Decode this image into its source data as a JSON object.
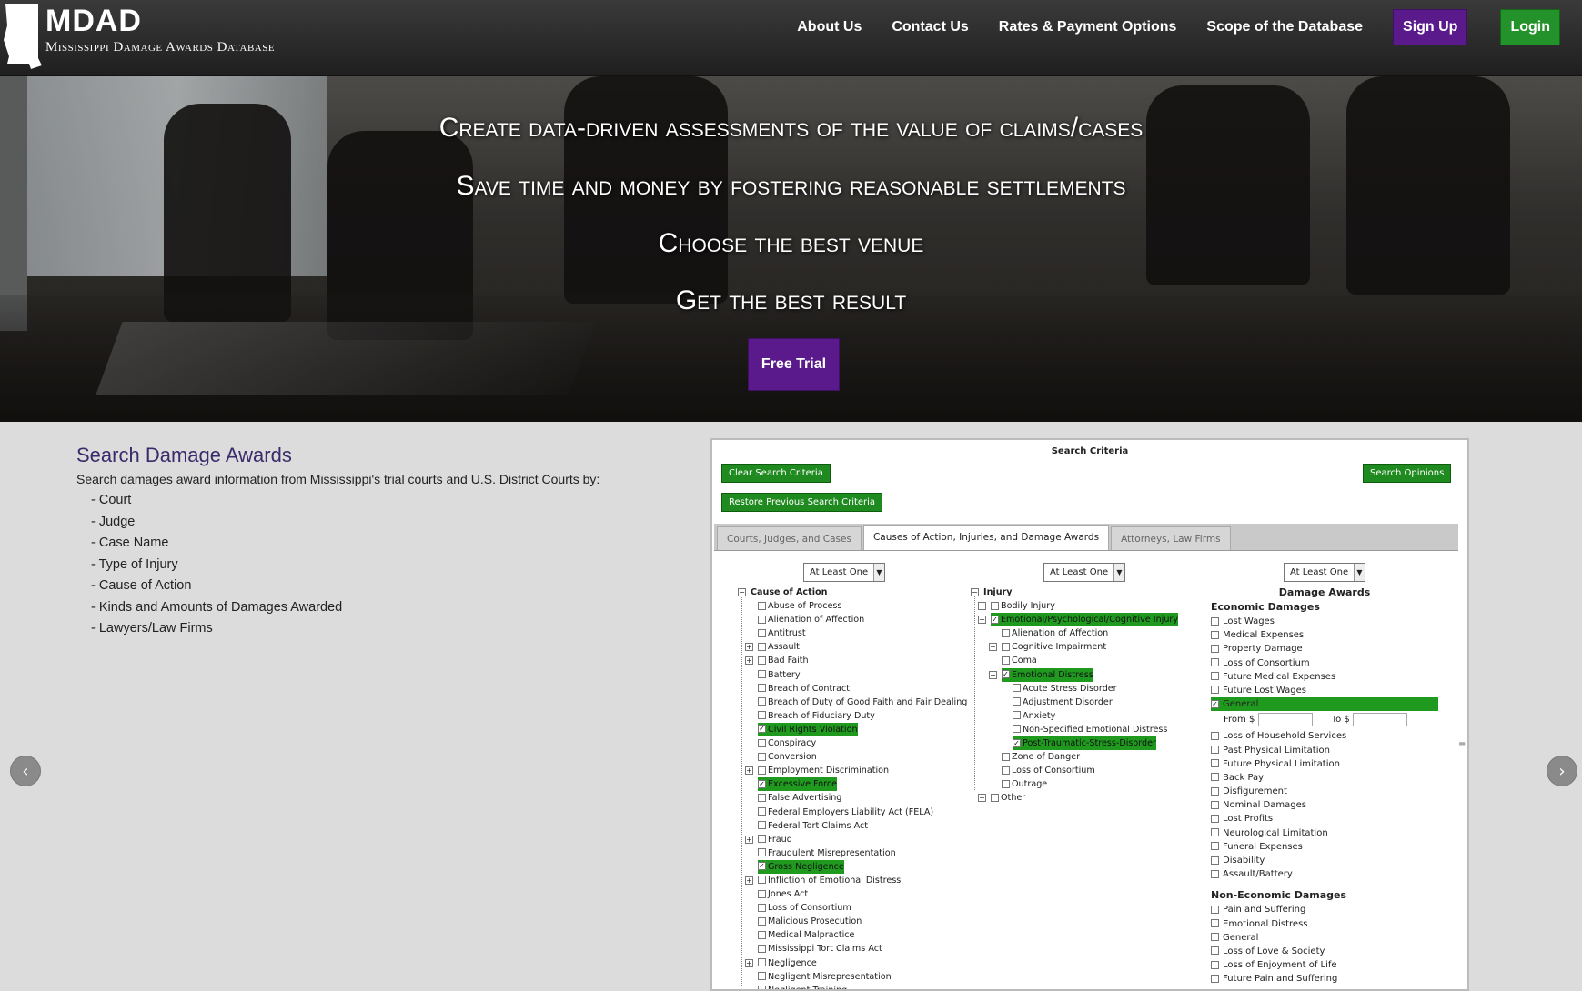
{
  "header": {
    "logo_title": "MDAD",
    "logo_subtitle": "Mississippi Damage Awards Database",
    "nav": [
      "About Us",
      "Contact Us",
      "Rates & Payment Options",
      "Scope of the Database"
    ],
    "signup_label": "Sign Up",
    "login_label": "Login"
  },
  "hero": {
    "taglines": [
      "Create data-driven assessments of the value of claims/cases",
      "Save time and money by fostering reasonable settlements",
      "Choose the best venue",
      "Get the best result"
    ],
    "trial_button": "Free Trial"
  },
  "info": {
    "title": "Search Damage Awards",
    "description": "Search damages award information from Mississippi's trial courts and U.S. District Courts by:",
    "items": [
      "- Court",
      "- Judge",
      "- Case Name",
      "- Type of Injury",
      "- Cause of Action",
      "- Kinds and Amounts of Damages Awarded",
      "- Lawyers/Law Firms"
    ]
  },
  "carousel": {
    "prev_icon": "‹",
    "next_icon": "›"
  },
  "panel": {
    "title": "Search Criteria",
    "clear_button": "Clear Search Criteria",
    "restore_button": "Restore Previous Search Criteria",
    "search_button": "Search Opinions",
    "tabs": [
      "Courts, Judges, and Cases",
      "Causes of Action, Injuries, and Damage Awards",
      "Attorneys, Law Firms"
    ],
    "active_tab": 1,
    "select_value": "At Least One",
    "cause_root": "Cause of Action",
    "causes": [
      {
        "label": "Abuse of Process",
        "exp": false,
        "checked": false,
        "hl": false
      },
      {
        "label": "Alienation of Affection",
        "exp": false,
        "checked": false,
        "hl": false
      },
      {
        "label": "Antitrust",
        "exp": false,
        "checked": false,
        "hl": false
      },
      {
        "label": "Assault",
        "exp": true,
        "checked": false,
        "hl": false
      },
      {
        "label": "Bad Faith",
        "exp": true,
        "checked": false,
        "hl": false
      },
      {
        "label": "Battery",
        "exp": false,
        "checked": false,
        "hl": false
      },
      {
        "label": "Breach of Contract",
        "exp": false,
        "checked": false,
        "hl": false
      },
      {
        "label": "Breach of Duty of Good Faith and Fair Dealing",
        "exp": false,
        "checked": false,
        "hl": false
      },
      {
        "label": "Breach of Fiduciary Duty",
        "exp": false,
        "checked": false,
        "hl": false
      },
      {
        "label": "Civil Rights Violation",
        "exp": false,
        "checked": true,
        "hl": true
      },
      {
        "label": "Conspiracy",
        "exp": false,
        "checked": false,
        "hl": false
      },
      {
        "label": "Conversion",
        "exp": false,
        "checked": false,
        "hl": false
      },
      {
        "label": "Employment Discrimination",
        "exp": true,
        "checked": false,
        "hl": false
      },
      {
        "label": "Excessive Force",
        "exp": false,
        "checked": true,
        "hl": true
      },
      {
        "label": "False Advertising",
        "exp": false,
        "checked": false,
        "hl": false
      },
      {
        "label": "Federal Employers Liability Act (FELA)",
        "exp": false,
        "checked": false,
        "hl": false
      },
      {
        "label": "Federal Tort Claims Act",
        "exp": false,
        "checked": false,
        "hl": false
      },
      {
        "label": "Fraud",
        "exp": true,
        "checked": false,
        "hl": false
      },
      {
        "label": "Fraudulent Misrepresentation",
        "exp": false,
        "checked": false,
        "hl": false
      },
      {
        "label": "Gross Negligence",
        "exp": false,
        "checked": true,
        "hl": true
      },
      {
        "label": "Infliction of Emotional Distress",
        "exp": true,
        "checked": false,
        "hl": false
      },
      {
        "label": "Jones Act",
        "exp": false,
        "checked": false,
        "hl": false
      },
      {
        "label": "Loss of Consortium",
        "exp": false,
        "checked": false,
        "hl": false
      },
      {
        "label": "Malicious Prosecution",
        "exp": false,
        "checked": false,
        "hl": false
      },
      {
        "label": "Medical Malpractice",
        "exp": false,
        "checked": false,
        "hl": false
      },
      {
        "label": "Mississippi Tort Claims Act",
        "exp": false,
        "checked": false,
        "hl": false
      },
      {
        "label": "Negligence",
        "exp": true,
        "checked": false,
        "hl": false
      },
      {
        "label": "Negligent Misrepresentation",
        "exp": false,
        "checked": false,
        "hl": false
      },
      {
        "label": "Negligent Training",
        "exp": false,
        "checked": false,
        "hl": false
      }
    ],
    "injury_root": "Injury",
    "injuries": [
      {
        "label": "Bodily Injury",
        "level": 0,
        "exp": "+",
        "checked": false,
        "hl": false
      },
      {
        "label": "Emotional/Psychological/Cognitive Injury",
        "level": 0,
        "exp": "-",
        "checked": true,
        "hl": true
      },
      {
        "label": "Alienation of Affection",
        "level": 1,
        "exp": "",
        "checked": false,
        "hl": false
      },
      {
        "label": "Cognitive Impairment",
        "level": 1,
        "exp": "+",
        "checked": false,
        "hl": false
      },
      {
        "label": "Coma",
        "level": 1,
        "exp": "",
        "checked": false,
        "hl": false
      },
      {
        "label": "Emotional Distress",
        "level": 1,
        "exp": "-",
        "checked": true,
        "hl": true
      },
      {
        "label": "Acute Stress Disorder",
        "level": 2,
        "exp": "",
        "checked": false,
        "hl": false
      },
      {
        "label": "Adjustment Disorder",
        "level": 2,
        "exp": "",
        "checked": false,
        "hl": false
      },
      {
        "label": "Anxiety",
        "level": 2,
        "exp": "",
        "checked": false,
        "hl": false
      },
      {
        "label": "Non-Specified Emotional Distress",
        "level": 2,
        "exp": "",
        "checked": false,
        "hl": false
      },
      {
        "label": "Post-Traumatic-Stress-Disorder",
        "level": 2,
        "exp": "",
        "checked": true,
        "hl": true
      },
      {
        "label": "Zone of Danger",
        "level": 1,
        "exp": "",
        "checked": false,
        "hl": false
      },
      {
        "label": "Loss of Consortium",
        "level": 1,
        "exp": "",
        "checked": false,
        "hl": false
      },
      {
        "label": "Outrage",
        "level": 1,
        "exp": "",
        "checked": false,
        "hl": false
      },
      {
        "label": "Other",
        "level": 0,
        "exp": "+",
        "checked": false,
        "hl": false
      }
    ],
    "damages_title": "Damage Awards",
    "economic_title": "Economic Damages",
    "economic_before": [
      {
        "label": "Lost Wages",
        "checked": false,
        "hl": false
      },
      {
        "label": "Medical Expenses",
        "checked": false,
        "hl": false
      },
      {
        "label": "Property Damage",
        "checked": false,
        "hl": false
      },
      {
        "label": "Loss of Consortium",
        "checked": false,
        "hl": false
      },
      {
        "label": "Future Medical Expenses",
        "checked": false,
        "hl": false
      },
      {
        "label": "Future Lost Wages",
        "checked": false,
        "hl": false
      },
      {
        "label": "General",
        "checked": true,
        "hl": true
      }
    ],
    "from_label": "From $",
    "to_label": "To $",
    "economic_after": [
      {
        "label": "Loss of Household Services",
        "checked": false
      },
      {
        "label": "Past Physical Limitation",
        "checked": false
      },
      {
        "label": "Future Physical Limitation",
        "checked": false
      },
      {
        "label": "Back Pay",
        "checked": false
      },
      {
        "label": "Disfigurement",
        "checked": false
      },
      {
        "label": "Nominal Damages",
        "checked": false
      },
      {
        "label": "Lost Profits",
        "checked": false
      },
      {
        "label": "Neurological Limitation",
        "checked": false
      },
      {
        "label": "Funeral Expenses",
        "checked": false
      },
      {
        "label": "Disability",
        "checked": false
      },
      {
        "label": "Assault/Battery",
        "checked": false
      }
    ],
    "noneconomic_title": "Non-Economic Damages",
    "noneconomic": [
      {
        "label": "Pain and Suffering",
        "checked": false
      },
      {
        "label": "Emotional Distress",
        "checked": false
      },
      {
        "label": "General",
        "checked": false
      },
      {
        "label": "Loss of Love & Society",
        "checked": false
      },
      {
        "label": "Loss of Enjoyment of Life",
        "checked": false
      },
      {
        "label": "Future Pain and Suffering",
        "checked": false
      }
    ]
  },
  "colors": {
    "purple": "#5b1a8c",
    "green": "#24922a",
    "highlight": "#1f9a1f"
  }
}
